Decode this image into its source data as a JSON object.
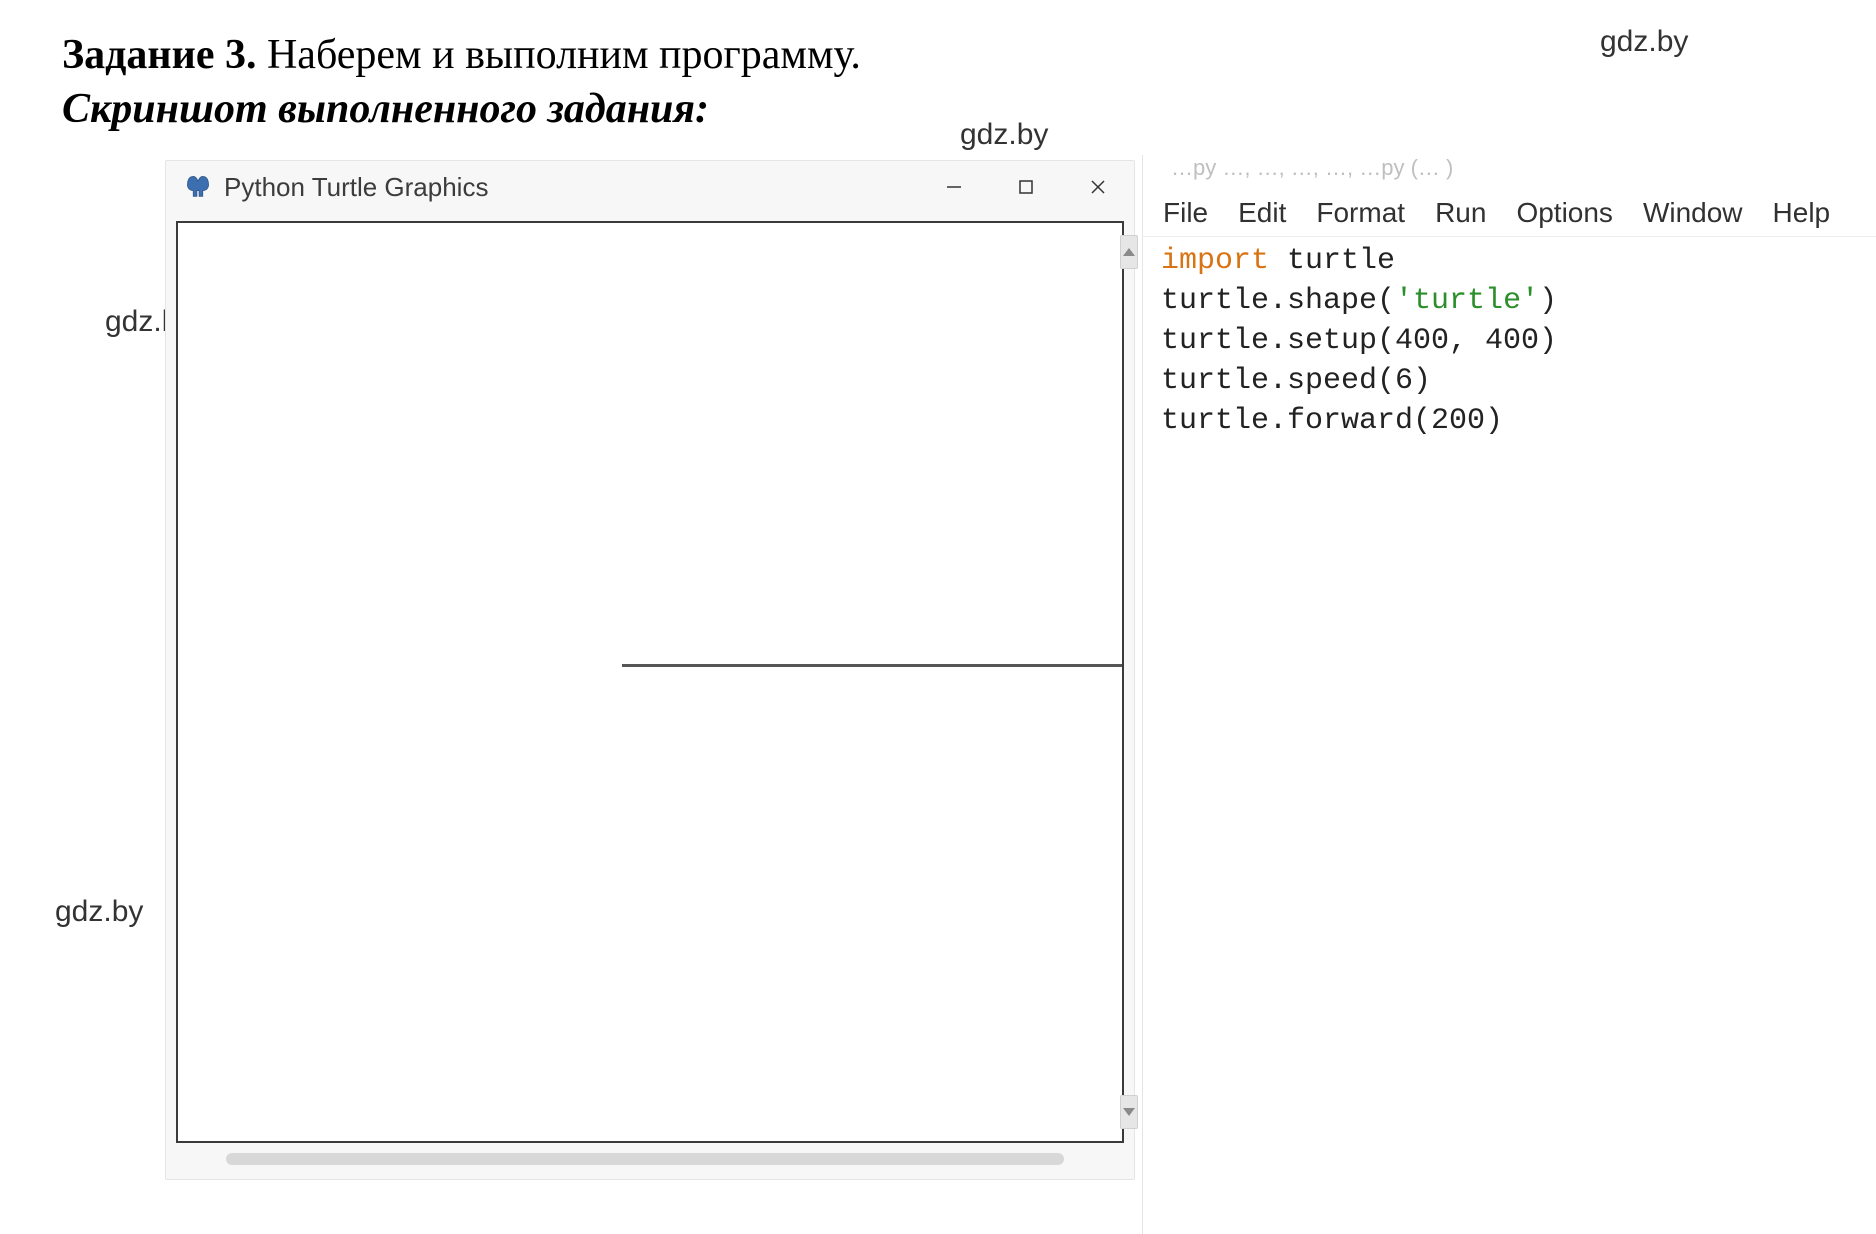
{
  "heading": {
    "task_label": "Задание 3.",
    "task_text": " Наберем и выполним программу.",
    "subtitle": "Скриншот выполненного задания:"
  },
  "watermark": "gdz.by",
  "turtle_window": {
    "title": "Python Turtle Graphics"
  },
  "idle_window": {
    "fragment_text": "…py   …, …, …, …, …py (… )",
    "menu": {
      "file": "File",
      "edit": "Edit",
      "format": "Format",
      "run": "Run",
      "options": "Options",
      "window": "Window",
      "help": "Help"
    },
    "code": {
      "kw_import": "import",
      "mod_turtle": " turtle",
      "l2_pre": "turtle.shape(",
      "l2_str": "'turtle'",
      "l2_post": ")",
      "l3": "turtle.setup(400, 400)",
      "l4": "turtle.speed(6)",
      "l5": "turtle.forward(200)"
    }
  }
}
